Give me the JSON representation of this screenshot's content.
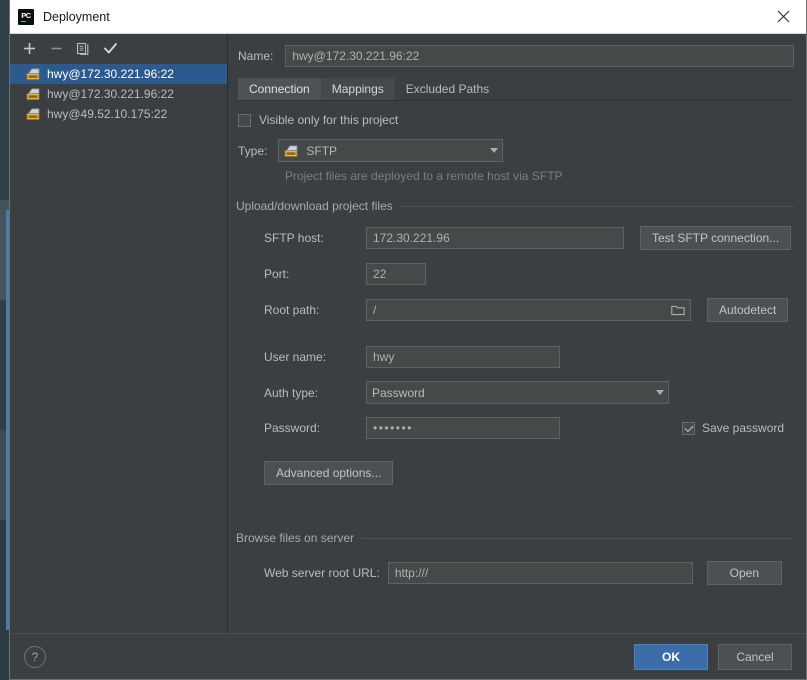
{
  "window": {
    "title": "Deployment",
    "app_icon": "pycharm-icon",
    "close_icon": "close-icon"
  },
  "sidebar": {
    "toolbar": [
      {
        "name": "add-button",
        "icon": "plus-icon",
        "label": "+"
      },
      {
        "name": "remove-button",
        "icon": "minus-icon",
        "label": "−"
      },
      {
        "name": "copy-button",
        "icon": "copy-icon",
        "label": "copy"
      },
      {
        "name": "set-default-button",
        "icon": "check-icon",
        "label": "✓"
      }
    ],
    "servers": [
      {
        "label": "hwy@172.30.221.96:22",
        "icon": "sftp-server-icon",
        "selected": true
      },
      {
        "label": "hwy@172.30.221.96:22",
        "icon": "sftp-server-icon",
        "selected": false
      },
      {
        "label": "hwy@49.52.10.175:22",
        "icon": "sftp-server-icon",
        "selected": false
      }
    ]
  },
  "form": {
    "name_label": "Name:",
    "name_value": "hwy@172.30.221.96:22",
    "tabs": [
      {
        "label": "Connection",
        "state": "active"
      },
      {
        "label": "Mappings",
        "state": "hover"
      },
      {
        "label": "Excluded Paths",
        "state": "normal"
      }
    ],
    "visible_only_label": "Visible only for this project",
    "visible_only_checked": false,
    "type_label": "Type:",
    "type_value": "SFTP",
    "type_icon": "sftp-server-icon",
    "type_hint": "Project files are deployed to a remote host via SFTP",
    "upload_group_title": "Upload/download project files",
    "sftp_host_label": "SFTP host:",
    "sftp_host_value": "172.30.221.96",
    "test_connection_label": "Test SFTP connection...",
    "port_label": "Port:",
    "port_value": "22",
    "root_path_label": "Root path:",
    "root_path_value": "/",
    "root_path_browse_icon": "folder-icon",
    "autodetect_label": "Autodetect",
    "user_name_label": "User name:",
    "user_name_value": "hwy",
    "auth_type_label": "Auth type:",
    "auth_type_value": "Password",
    "password_label": "Password:",
    "password_value": "•••••••",
    "save_password_label": "Save password",
    "save_password_checked": true,
    "advanced_options_label": "Advanced options...",
    "browse_group_title": "Browse files on server",
    "web_url_label": "Web server root URL:",
    "web_url_value": "http:///",
    "open_label": "Open"
  },
  "footer": {
    "help_label": "?",
    "ok_label": "OK",
    "cancel_label": "Cancel"
  },
  "colors": {
    "dialog_bg": "#3c3f41",
    "selection_blue": "#2d5a8e",
    "primary_button": "#3b6ea8",
    "field_bg": "#45494a"
  }
}
